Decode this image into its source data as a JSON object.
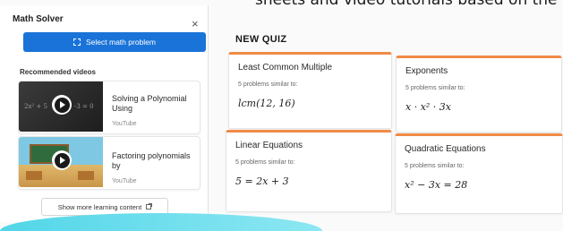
{
  "page": {
    "headline": "sheets and video tutorials based on the equation solved."
  },
  "panel": {
    "title": "Math Solver",
    "close_glyph": "×",
    "select_button": "Select math problem",
    "recommended_label": "Recommended videos",
    "videos": [
      {
        "title": "Solving a Polynomial Using",
        "source": "YouTube",
        "thumb_left": "2x² + 5",
        "thumb_right": "-3 = 0"
      },
      {
        "title": "Factoring polynomials by",
        "source": "YouTube"
      }
    ],
    "more_button": "Show more learning content"
  },
  "quiz": {
    "label": "NEW QUIZ",
    "cards": [
      {
        "title": "Least Common Multiple",
        "subtitle": "5 problems similar to:",
        "equation": "lcm(12, 16)"
      },
      {
        "title": "Exponents",
        "subtitle": "5 problems similar to:",
        "equation": "x · x² · 3x"
      },
      {
        "title": "Linear Equations",
        "subtitle": "5 problems similar to:",
        "equation": "5 = 2x + 3"
      },
      {
        "title": "Quadratic Equations",
        "subtitle": "5 problems similar to:",
        "equation": "x² − 3x = 28"
      }
    ]
  },
  "icons": {
    "select": "selection-square-icon",
    "play": "play-icon",
    "external": "external-link-icon",
    "close": "close-icon"
  },
  "colors": {
    "primary": "#1a73d8",
    "card_accent": "#f08a45",
    "bottom_accent": "#52d6e8"
  }
}
